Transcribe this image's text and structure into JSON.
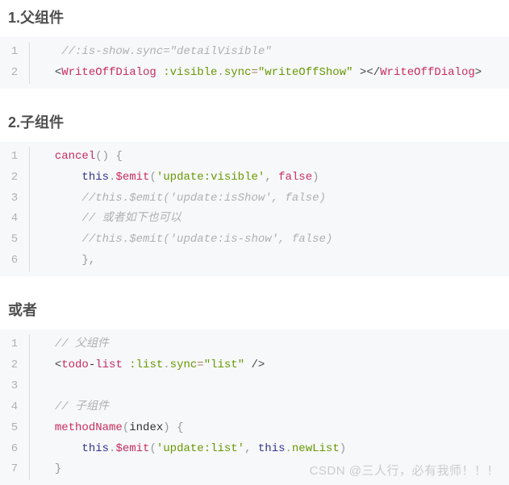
{
  "sections": [
    {
      "title": "1.父组件"
    },
    {
      "title": "2.子组件"
    },
    {
      "title": "或者"
    }
  ],
  "block1": {
    "lines": [
      "1",
      "2"
    ],
    "l1_comment": "//:is-show.sync=\"detailVisible\"",
    "l2_tag": "WriteOffDialog",
    "l2_attr1": ":visible",
    "l2_attr2": "sync",
    "l2_val": "\"writeOffShow\""
  },
  "block2": {
    "lines": [
      "1",
      "2",
      "3",
      "4",
      "5",
      "6"
    ],
    "cancel": "cancel",
    "this": "this",
    "emit": "$emit",
    "arg1": "'update:visible'",
    "false": "false",
    "c3": "//this.$emit('update:isShow', false)",
    "c4": "// 或者如下也可以",
    "c5": "//this.$emit('update:is-show', false)",
    "end": "},"
  },
  "block3": {
    "lines": [
      "1",
      "2",
      "3",
      "4",
      "5",
      "6",
      "7"
    ],
    "c1": "// 父组件",
    "tag": "todo",
    "tag2": "list",
    "attr1": ":list",
    "attr2": "sync",
    "val": "\"list\"",
    "c4": "// 子组件",
    "method": "methodName",
    "param": "index",
    "this": "this",
    "emit": "$emit",
    "arg1": "'update:list'",
    "newList": "newList"
  },
  "watermark": "CSDN @三人行，必有我师！！！"
}
